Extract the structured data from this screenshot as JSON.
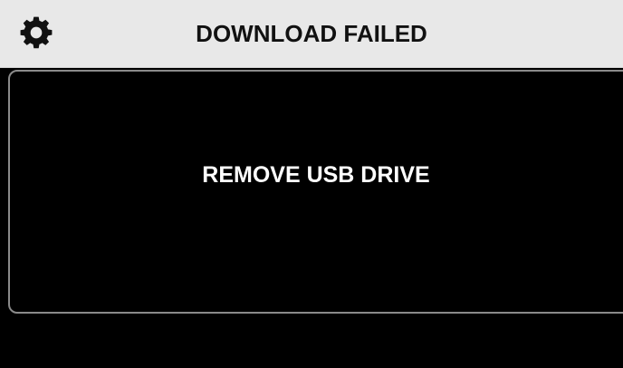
{
  "header": {
    "title": "DOWNLOAD FAILED",
    "settings_icon": "gear-icon",
    "background_color": "#e8e8e8",
    "text_color": "#111111"
  },
  "main": {
    "message": "REMOVE USB DRIVE",
    "background_color": "#000000",
    "text_color": "#ffffff",
    "panel_border_color": "#8a8a8a"
  }
}
